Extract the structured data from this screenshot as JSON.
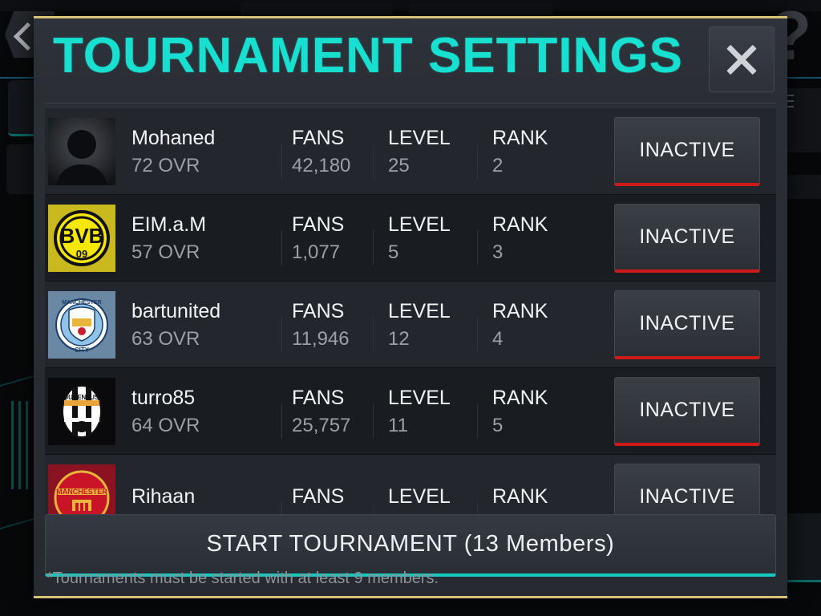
{
  "background": {
    "back_icon": "back-arrow-icon",
    "help_label": "?"
  },
  "modal": {
    "title": "TOURNAMENT SETTINGS",
    "close_icon": "close-icon",
    "columns": {
      "fans": "FANS",
      "level": "LEVEL",
      "rank": "RANK"
    },
    "members": [
      {
        "name": "Mohaned",
        "ovr": "72 OVR",
        "fans_label": "FANS",
        "fans": "42,180",
        "level_label": "LEVEL",
        "level": "25",
        "rank_label": "RANK",
        "rank": "2",
        "status": "INACTIVE",
        "badge": "default-avatar-icon"
      },
      {
        "name": "EIM.a.M",
        "ovr": "57 OVR",
        "fans_label": "FANS",
        "fans": "1,077",
        "level_label": "LEVEL",
        "level": "5",
        "rank_label": "RANK",
        "rank": "3",
        "status": "INACTIVE",
        "badge": "borussia-dortmund-crest-icon"
      },
      {
        "name": "bartunited",
        "ovr": "63 OVR",
        "fans_label": "FANS",
        "fans": "11,946",
        "level_label": "LEVEL",
        "level": "12",
        "rank_label": "RANK",
        "rank": "4",
        "status": "INACTIVE",
        "badge": "manchester-city-crest-icon"
      },
      {
        "name": "turro85",
        "ovr": "64 OVR",
        "fans_label": "FANS",
        "fans": "25,757",
        "level_label": "LEVEL",
        "level": "11",
        "rank_label": "RANK",
        "rank": "5",
        "status": "INACTIVE",
        "badge": "juventus-crest-icon"
      },
      {
        "name": "Rihaan",
        "ovr": "",
        "fans_label": "FANS",
        "fans": "",
        "level_label": "LEVEL",
        "level": "",
        "rank_label": "RANK",
        "rank": "",
        "status": "INACTIVE",
        "badge": "manchester-united-crest-icon"
      }
    ],
    "start_button": "START TOURNAMENT (13 Members)",
    "footnote": "*Tournaments must be started with at least 9 members."
  },
  "colors": {
    "title_cyan": "#18e0d0",
    "modal_border_gold": "#d8c278",
    "inactive_underline_red": "#d01a1a",
    "start_underline_teal": "#15c9c0"
  }
}
